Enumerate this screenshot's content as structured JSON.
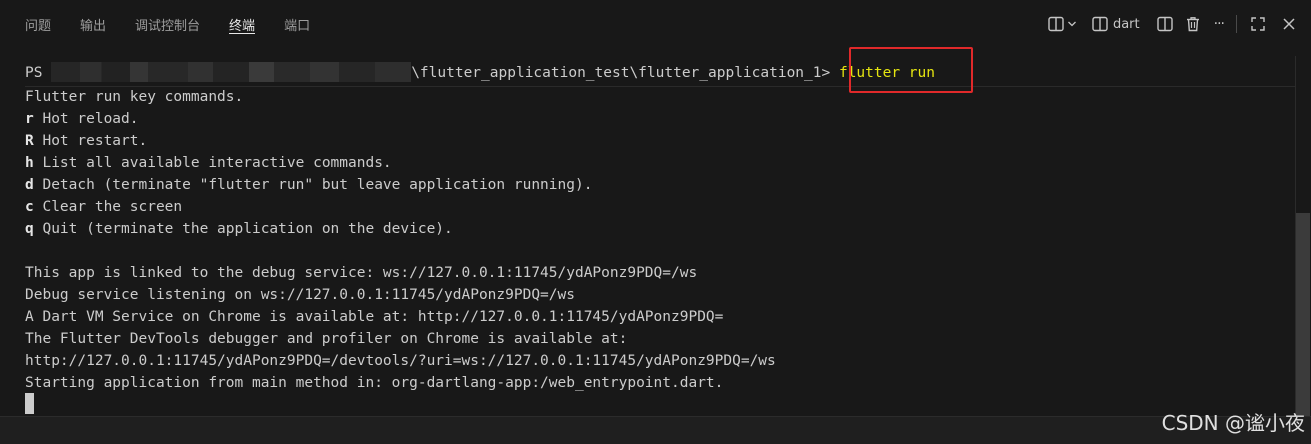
{
  "tabs": [
    {
      "label": "问题",
      "active": false
    },
    {
      "label": "输出",
      "active": false
    },
    {
      "label": "调试控制台",
      "active": false
    },
    {
      "label": "终端",
      "active": true
    },
    {
      "label": "端口",
      "active": false
    }
  ],
  "actions": {
    "new_terminal_icon": "split-layout-icon",
    "profile_label": "dart",
    "more_label": "···"
  },
  "terminal": {
    "prompt_prefix": "PS ",
    "prompt_path": "\\flutter_application_test\\flutter_application_1> ",
    "command": "flutter run",
    "header": "Flutter run key commands.",
    "key_commands": [
      {
        "key": "r",
        "text": " Hot reload."
      },
      {
        "key": "R",
        "text": " Hot restart."
      },
      {
        "key": "h",
        "text": " List all available interactive commands."
      },
      {
        "key": "d",
        "text": " Detach (terminate \"flutter run\" but leave application running)."
      },
      {
        "key": "c",
        "text": " Clear the screen"
      },
      {
        "key": "q",
        "text": " Quit (terminate the application on the device)."
      }
    ],
    "output_lines": [
      "This app is linked to the debug service: ws://127.0.0.1:11745/ydAPonz9PDQ=/ws",
      "Debug service listening on ws://127.0.0.1:11745/ydAPonz9PDQ=/ws",
      "A Dart VM Service on Chrome is available at: http://127.0.0.1:11745/ydAPonz9PDQ=",
      "The Flutter DevTools debugger and profiler on Chrome is available at:",
      "http://127.0.0.1:11745/ydAPonz9PDQ=/devtools/?uri=ws://127.0.0.1:11745/ydAPonz9PDQ=/ws",
      "Starting application from main method in: org-dartlang-app:/web_entrypoint.dart."
    ]
  },
  "watermark": "CSDN @谧小夜",
  "colors": {
    "background": "#181818",
    "command": "#e5e510",
    "highlight_box": "#e0292a",
    "text": "#cccccc"
  }
}
